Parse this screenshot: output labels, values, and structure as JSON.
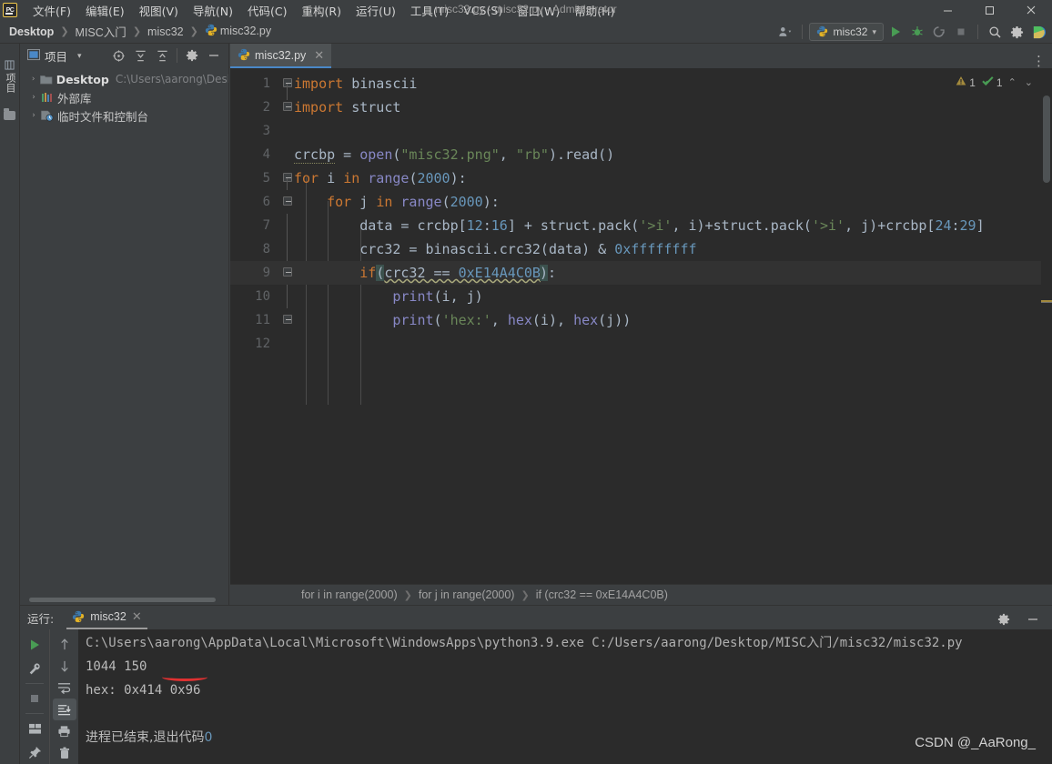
{
  "window": {
    "title": "misc32.py - misc32.py - Administrator",
    "logo_text": "PC",
    "minimize": "—",
    "maximize": "☐",
    "close": "✕"
  },
  "menu": {
    "items": [
      {
        "label": "文件(F)"
      },
      {
        "label": "编辑(E)"
      },
      {
        "label": "视图(V)"
      },
      {
        "label": "导航(N)"
      },
      {
        "label": "代码(C)"
      },
      {
        "label": "重构(R)"
      },
      {
        "label": "运行(U)"
      },
      {
        "label": "工具(T)"
      },
      {
        "label": "VCS(S)"
      },
      {
        "label": "窗口(W)"
      },
      {
        "label": "帮助(H)"
      }
    ]
  },
  "navbar": {
    "breadcrumbs": [
      {
        "label": "Desktop",
        "bold": true,
        "icon": null
      },
      {
        "label": "MISC入门",
        "bold": false,
        "icon": null
      },
      {
        "label": "misc32",
        "bold": false,
        "icon": null
      },
      {
        "label": "misc32.py",
        "bold": false,
        "icon": "python-file-icon"
      }
    ],
    "separator": "❯",
    "run_config": "misc32",
    "dropdown_caret": "▾",
    "actions": [
      {
        "name": "run-button",
        "label": "Run"
      },
      {
        "name": "debug-button",
        "label": "Debug"
      },
      {
        "name": "run-coverage-button",
        "label": "Run with Coverage"
      },
      {
        "name": "stop-button",
        "label": "Stop"
      },
      {
        "name": "search-button",
        "label": "Search Everywhere"
      },
      {
        "name": "settings-button",
        "label": "Settings"
      },
      {
        "name": "ide-assistant-button",
        "label": "Assistant"
      }
    ]
  },
  "left_strip": {
    "project_tab": "项目"
  },
  "project_panel": {
    "title": "项目",
    "title_caret": "▾",
    "toolbar": [
      {
        "name": "select-opened-file-icon",
        "label": "Select Opened File"
      },
      {
        "name": "expand-all-icon",
        "label": "Expand All"
      },
      {
        "name": "collapse-all-icon",
        "label": "Collapse All"
      },
      {
        "name": "settings-gear-icon",
        "label": "Options"
      },
      {
        "name": "hide-panel-icon",
        "label": "Hide"
      }
    ],
    "tree": [
      {
        "arrow": "›",
        "icon": "folder-icon",
        "label": "Desktop",
        "bold": true,
        "sub": "C:\\Users\\aarong\\Desk"
      },
      {
        "arrow": "›",
        "icon": "library-icon",
        "label": "外部库",
        "bold": false,
        "sub": ""
      },
      {
        "arrow": "›",
        "icon": "scratches-icon",
        "label": "临时文件和控制台",
        "bold": false,
        "sub": ""
      }
    ]
  },
  "editor": {
    "tab": {
      "label": "misc32.py",
      "icon": "python-file-icon",
      "close": "✕"
    },
    "overflow_menu": "⋮",
    "inspections": {
      "warning_icon": "warning-triangle-icon",
      "warning_count": "1",
      "ok_icon": "inspection-ok-icon",
      "ok_count": "1",
      "prev": "⌃",
      "next": "⌄"
    },
    "current_line": 9,
    "lines": [
      {
        "no": "1",
        "text": "import binascii"
      },
      {
        "no": "2",
        "text": "import struct"
      },
      {
        "no": "3",
        "text": ""
      },
      {
        "no": "4",
        "text": "crcbp = open(\"misc32.png\", \"rb\").read()"
      },
      {
        "no": "5",
        "text": "for i in range(2000):"
      },
      {
        "no": "6",
        "text": "    for j in range(2000):"
      },
      {
        "no": "7",
        "text": "        data = crcbp[12:16] + struct.pack('>i', i)+struct.pack('>i', j)+crcbp[24:29]"
      },
      {
        "no": "8",
        "text": "        crc32 = binascii.crc32(data) & 0xffffffff"
      },
      {
        "no": "9",
        "text": "        if(crc32 == 0xE14A4C0B):"
      },
      {
        "no": "10",
        "text": "            print(i, j)"
      },
      {
        "no": "11",
        "text": "            print('hex:', hex(i), hex(j))"
      },
      {
        "no": "12",
        "text": ""
      }
    ],
    "breadcrumbs": [
      "for i in range(2000)",
      "for j in range(2000)",
      "if (crc32 == 0xE14A4C0B)"
    ],
    "breadcrumb_sep": "❯"
  },
  "run_panel": {
    "label": "运行:",
    "tab": {
      "label": "misc32",
      "icon": "python-file-icon",
      "close": "✕"
    },
    "header_actions": [
      {
        "name": "run-settings-gear-icon",
        "label": "Settings"
      },
      {
        "name": "hide-run-panel-icon",
        "label": "Hide"
      }
    ],
    "left_toolbar": [
      {
        "name": "rerun-button",
        "label": "Rerun"
      },
      {
        "name": "edit-configuration-button",
        "label": "Edit Configuration"
      },
      {
        "name": "stop-process-button",
        "label": "Stop"
      },
      {
        "name": "layout-button",
        "label": "Layout"
      },
      {
        "name": "pin-tab-button",
        "label": "Pin Tab"
      }
    ],
    "right_toolbar": [
      {
        "name": "scroll-up-button",
        "label": "Up"
      },
      {
        "name": "scroll-down-button",
        "label": "Down"
      },
      {
        "name": "soft-wrap-button",
        "label": "Soft-Wrap"
      },
      {
        "name": "scroll-to-end-button",
        "label": "Scroll to End"
      },
      {
        "name": "print-button",
        "label": "Print"
      },
      {
        "name": "clear-all-button",
        "label": "Clear All"
      }
    ],
    "console": [
      {
        "text": "C:\\Users\\aarong\\AppData\\Local\\Microsoft\\WindowsApps\\python3.9.exe C:/Users/aarong/Desktop/MISC入门/misc32/misc32.py",
        "type": "cmd"
      },
      {
        "text": "1044 150",
        "type": "out"
      },
      {
        "text": "hex: 0x414 0x96",
        "type": "out"
      }
    ],
    "exit_text": "进程已结束,退出代码",
    "exit_code": "0",
    "highlighted_value": "1044"
  },
  "watermark": "CSDN @_AaRong_",
  "colors": {
    "bg_chrome": "#3c3f41",
    "bg_editor": "#2b2b2b",
    "accent_tab": "#4a88c7",
    "keyword": "#cc7832",
    "string": "#6a8759",
    "number": "#6897bb",
    "function": "#ffc66d",
    "builtin": "#8888c6",
    "text": "#a9b7c6",
    "run_green": "#499c54",
    "highlight_red": "#e03131"
  }
}
